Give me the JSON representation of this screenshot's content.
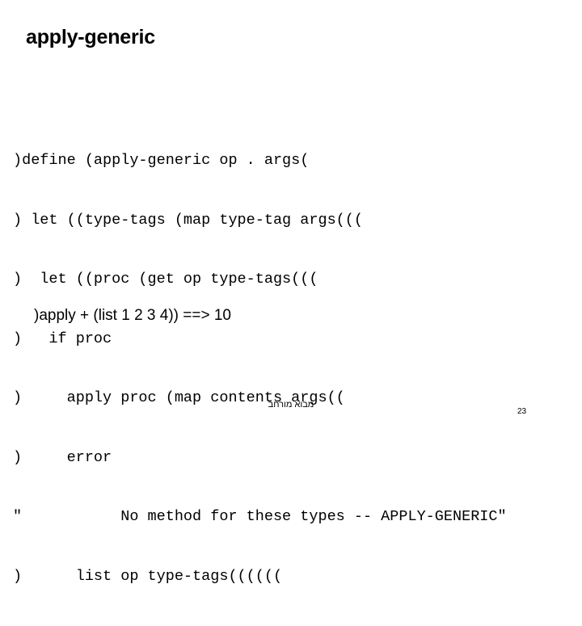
{
  "slide": {
    "title": "apply-generic",
    "page_number": "23",
    "footer_text": "מבוא מורחב",
    "background_color": "#ffffff",
    "text_color": "#000000"
  },
  "code": {
    "language": "scheme",
    "note": "parentheses rendered mirrored due to RTL text direction",
    "lines": [
      ")define (apply-generic op . args(",
      ") let ((type-tags (map type-tag args(((",
      ")  let ((proc (get op type-tags(((",
      ")   if proc",
      ")     apply proc (map contents args((",
      ")     error",
      "\"           No method for these types -- APPLY-GENERIC\"",
      ")      list op type-tags(((((("
    ]
  },
  "result": {
    "expression": ")apply + (list 1 2 3 4)) ==> 10"
  }
}
